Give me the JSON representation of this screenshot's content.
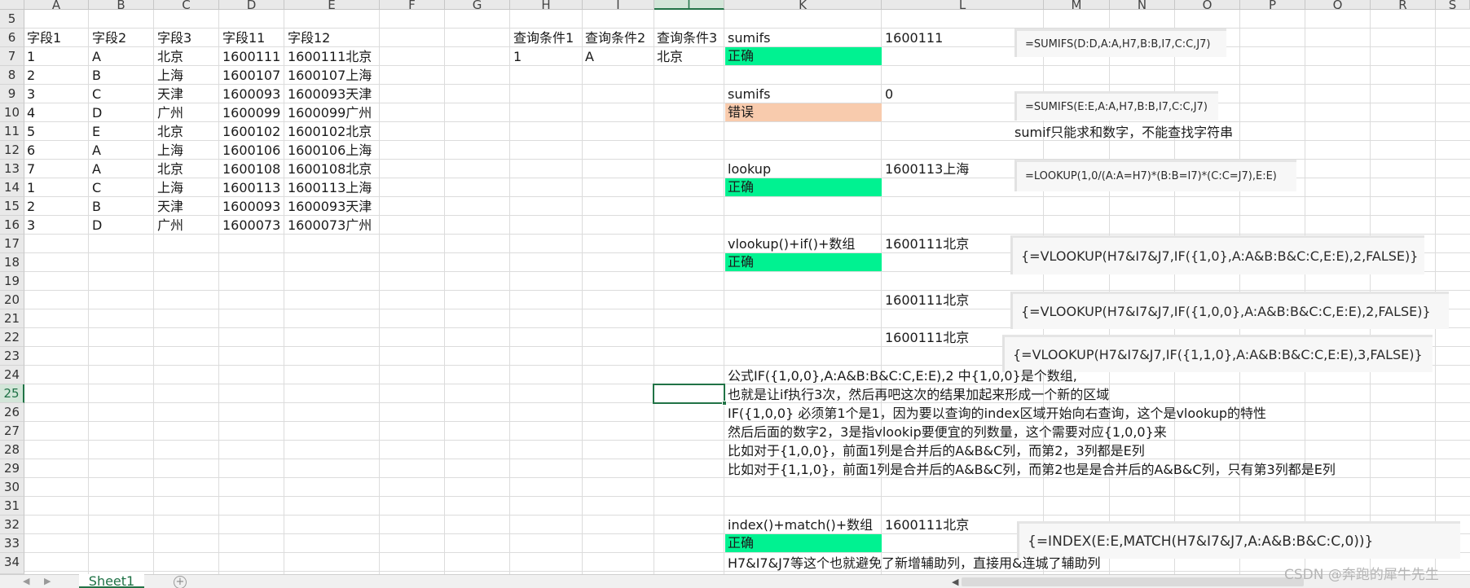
{
  "columns": [
    "A",
    "B",
    "C",
    "D",
    "E",
    "F",
    "G",
    "H",
    "I",
    "J",
    "K",
    "L",
    "M",
    "N",
    "O",
    "P",
    "Q",
    "R",
    "S"
  ],
  "active_column": "J",
  "rows": [
    "5",
    "6",
    "7",
    "8",
    "9",
    "10",
    "11",
    "12",
    "13",
    "14",
    "15",
    "16",
    "17",
    "18",
    "19",
    "20",
    "21",
    "22",
    "23",
    "24",
    "25",
    "26",
    "27",
    "28",
    "29",
    "30",
    "31",
    "32",
    "33",
    "34"
  ],
  "active_row": "25",
  "table": {
    "headers": [
      "字段1",
      "字段2",
      "字段3",
      "字段11",
      "字段12"
    ],
    "rows": [
      [
        "1",
        "A",
        "北京",
        "1600111",
        "1600111北京"
      ],
      [
        "2",
        "B",
        "上海",
        "1600107",
        "1600107上海"
      ],
      [
        "3",
        "C",
        "天津",
        "1600093",
        "1600093天津"
      ],
      [
        "4",
        "D",
        "广州",
        "1600099",
        "1600099广州"
      ],
      [
        "5",
        "E",
        "北京",
        "1600102",
        "1600102北京"
      ],
      [
        "6",
        "A",
        "上海",
        "1600106",
        "1600106上海"
      ],
      [
        "7",
        "A",
        "北京",
        "1600108",
        "1600108北京"
      ],
      [
        "1",
        "C",
        "上海",
        "1600113",
        "1600113上海"
      ],
      [
        "2",
        "B",
        "天津",
        "1600093",
        "1600093天津"
      ],
      [
        "3",
        "D",
        "广州",
        "1600073",
        "1600073广州"
      ]
    ]
  },
  "query": {
    "headers": [
      "查询条件1",
      "查询条件2",
      "查询条件3"
    ],
    "values": [
      "1",
      "A",
      "北京"
    ]
  },
  "methods": [
    {
      "label": "sumifs",
      "status": "正确",
      "status_color": "#00f291",
      "result": "1600111",
      "formula": "=SUMIFS(D:D,A:A,H7,B:B,I7,C:C,J7)"
    },
    {
      "label": "sumifs",
      "status": "错误",
      "status_color": "#f8cbad",
      "result": "0",
      "formula": "=SUMIFS(E:E,A:A,H7,B:B,I7,C:C,J7)",
      "note": "sumif只能求和数字，不能查找字符串"
    },
    {
      "label": "lookup",
      "status": "正确",
      "status_color": "#00f291",
      "result": "1600113上海",
      "formula": "=LOOKUP(1,0/(A:A=H7)*(B:B=I7)*(C:C=J7),E:E)"
    },
    {
      "label": "vlookup()+if()+数组",
      "status": "正确",
      "status_color": "#00f291",
      "result": "1600111北京",
      "formula": "{=VLOOKUP(H7&I7&J7,IF({1,0},A:A&B:B&C:C,E:E),2,FALSE)}"
    },
    {
      "result": "1600111北京",
      "formula": "{=VLOOKUP(H7&I7&J7,IF({1,0,0},A:A&B:B&C:C,E:E),2,FALSE)}"
    },
    {
      "result": "1600111北京",
      "formula": "{=VLOOKUP(H7&I7&J7,IF({1,1,0},A:A&B:B&C:C,E:E),3,FALSE)}"
    },
    {
      "label": "index()+match()+数组",
      "status": "正确",
      "status_color": "#00f291",
      "result": "1600111北京",
      "formula": "{=INDEX(E:E,MATCH(H7&I7&J7,A:A&B:B&C:C,0))}",
      "note": "H7&I7&J7等这个也就避免了新增辅助列，直接用&连城了辅助列"
    }
  ],
  "explanation": [
    "公式IF({1,0,0},A:A&B:B&C:C,E:E),2 中{1,0,0}是个数组,",
    "也就是让if执行3次，然后再吧这次的结果加起来形成一个新的区域",
    "IF({1,0,0} 必须第1个是1，因为要以查询的index区域开始向右查询，这个是vlookup的特性",
    "然后后面的数字2，3是指vlookip要便宜的列数量，这个需要对应{1,0,0}来",
    "比如对于{1,0,0}，前面1列是合并后的A&B&C列，而第2，3列都是E列",
    "比如对于{1,1,0}，前面1列是合并后的A&B&C列，而第2也是是合并后的A&B&C列，只有第3列都是E列"
  ],
  "sheet_tab": "Sheet1",
  "watermark": "CSDN @奔跑的犀牛先生",
  "colors": {
    "accent": "#217346",
    "ok": "#00f291",
    "error": "#f8cbad"
  }
}
